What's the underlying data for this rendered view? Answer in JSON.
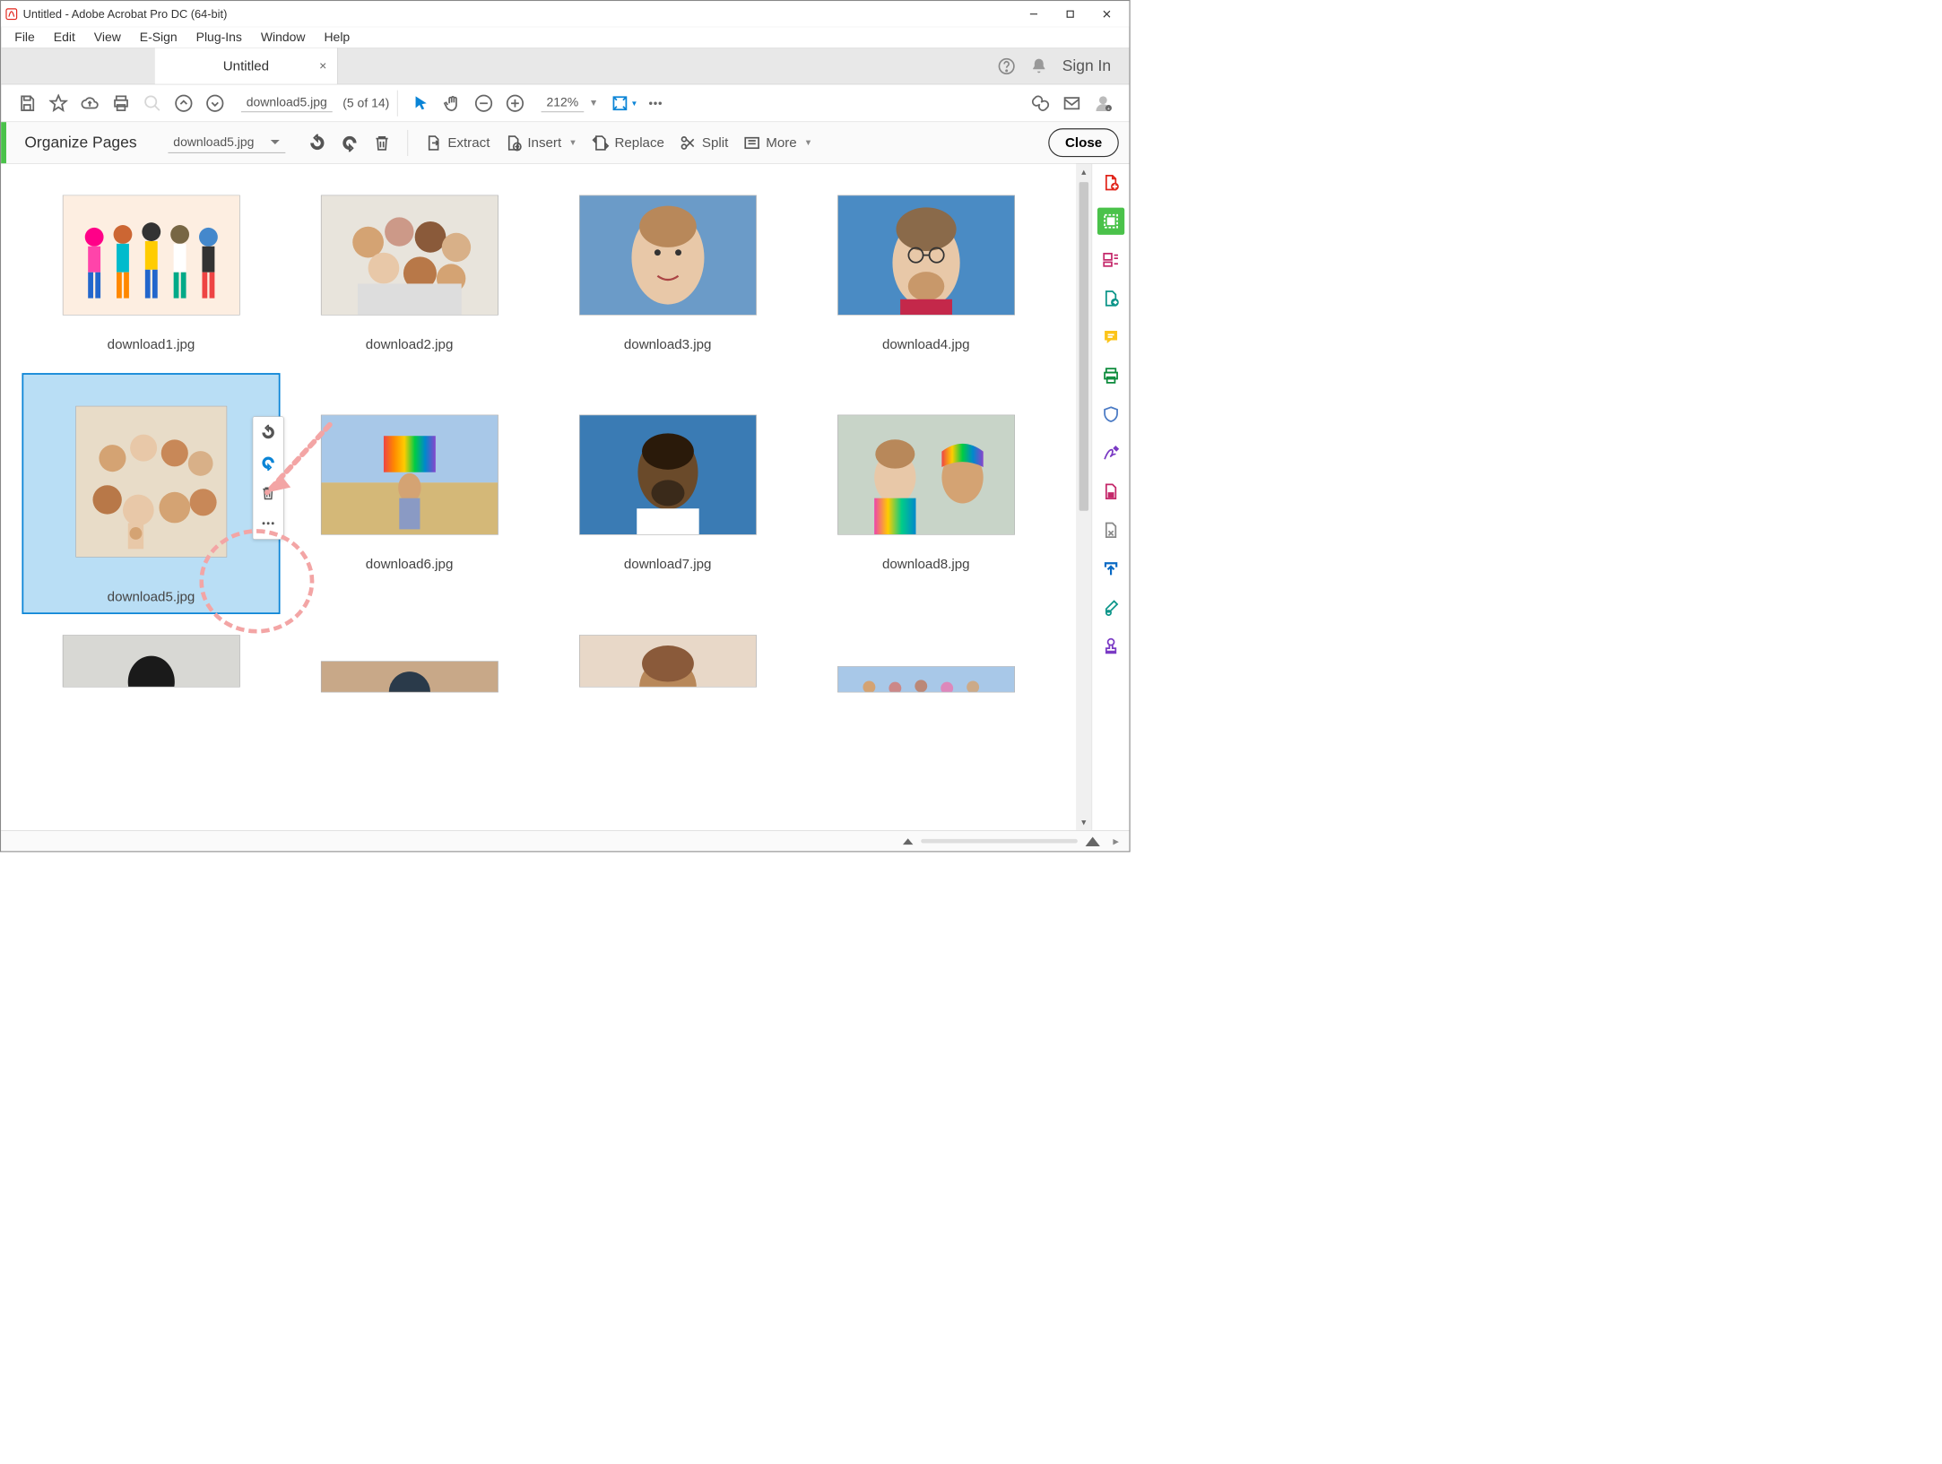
{
  "window": {
    "title": "Untitled - Adobe Acrobat Pro DC (64-bit)"
  },
  "menubar": [
    "File",
    "Edit",
    "View",
    "E-Sign",
    "Plug-Ins",
    "Window",
    "Help"
  ],
  "tab": {
    "label": "Untitled"
  },
  "tabbar": {
    "signin": "Sign In"
  },
  "toolbar": {
    "filename": "download5.jpg",
    "position": "(5 of 14)",
    "zoom": "212%"
  },
  "organize": {
    "title": "Organize Pages",
    "file": "download5.jpg",
    "extract": "Extract",
    "insert": "Insert",
    "replace": "Replace",
    "split": "Split",
    "more": "More",
    "close": "Close"
  },
  "pages": [
    {
      "label": "download1.jpg",
      "selected": false
    },
    {
      "label": "download2.jpg",
      "selected": false
    },
    {
      "label": "download3.jpg",
      "selected": false
    },
    {
      "label": "download4.jpg",
      "selected": false
    },
    {
      "label": "download5.jpg",
      "selected": true
    },
    {
      "label": "download6.jpg",
      "selected": false
    },
    {
      "label": "download7.jpg",
      "selected": false
    },
    {
      "label": "download8.jpg",
      "selected": false
    }
  ]
}
